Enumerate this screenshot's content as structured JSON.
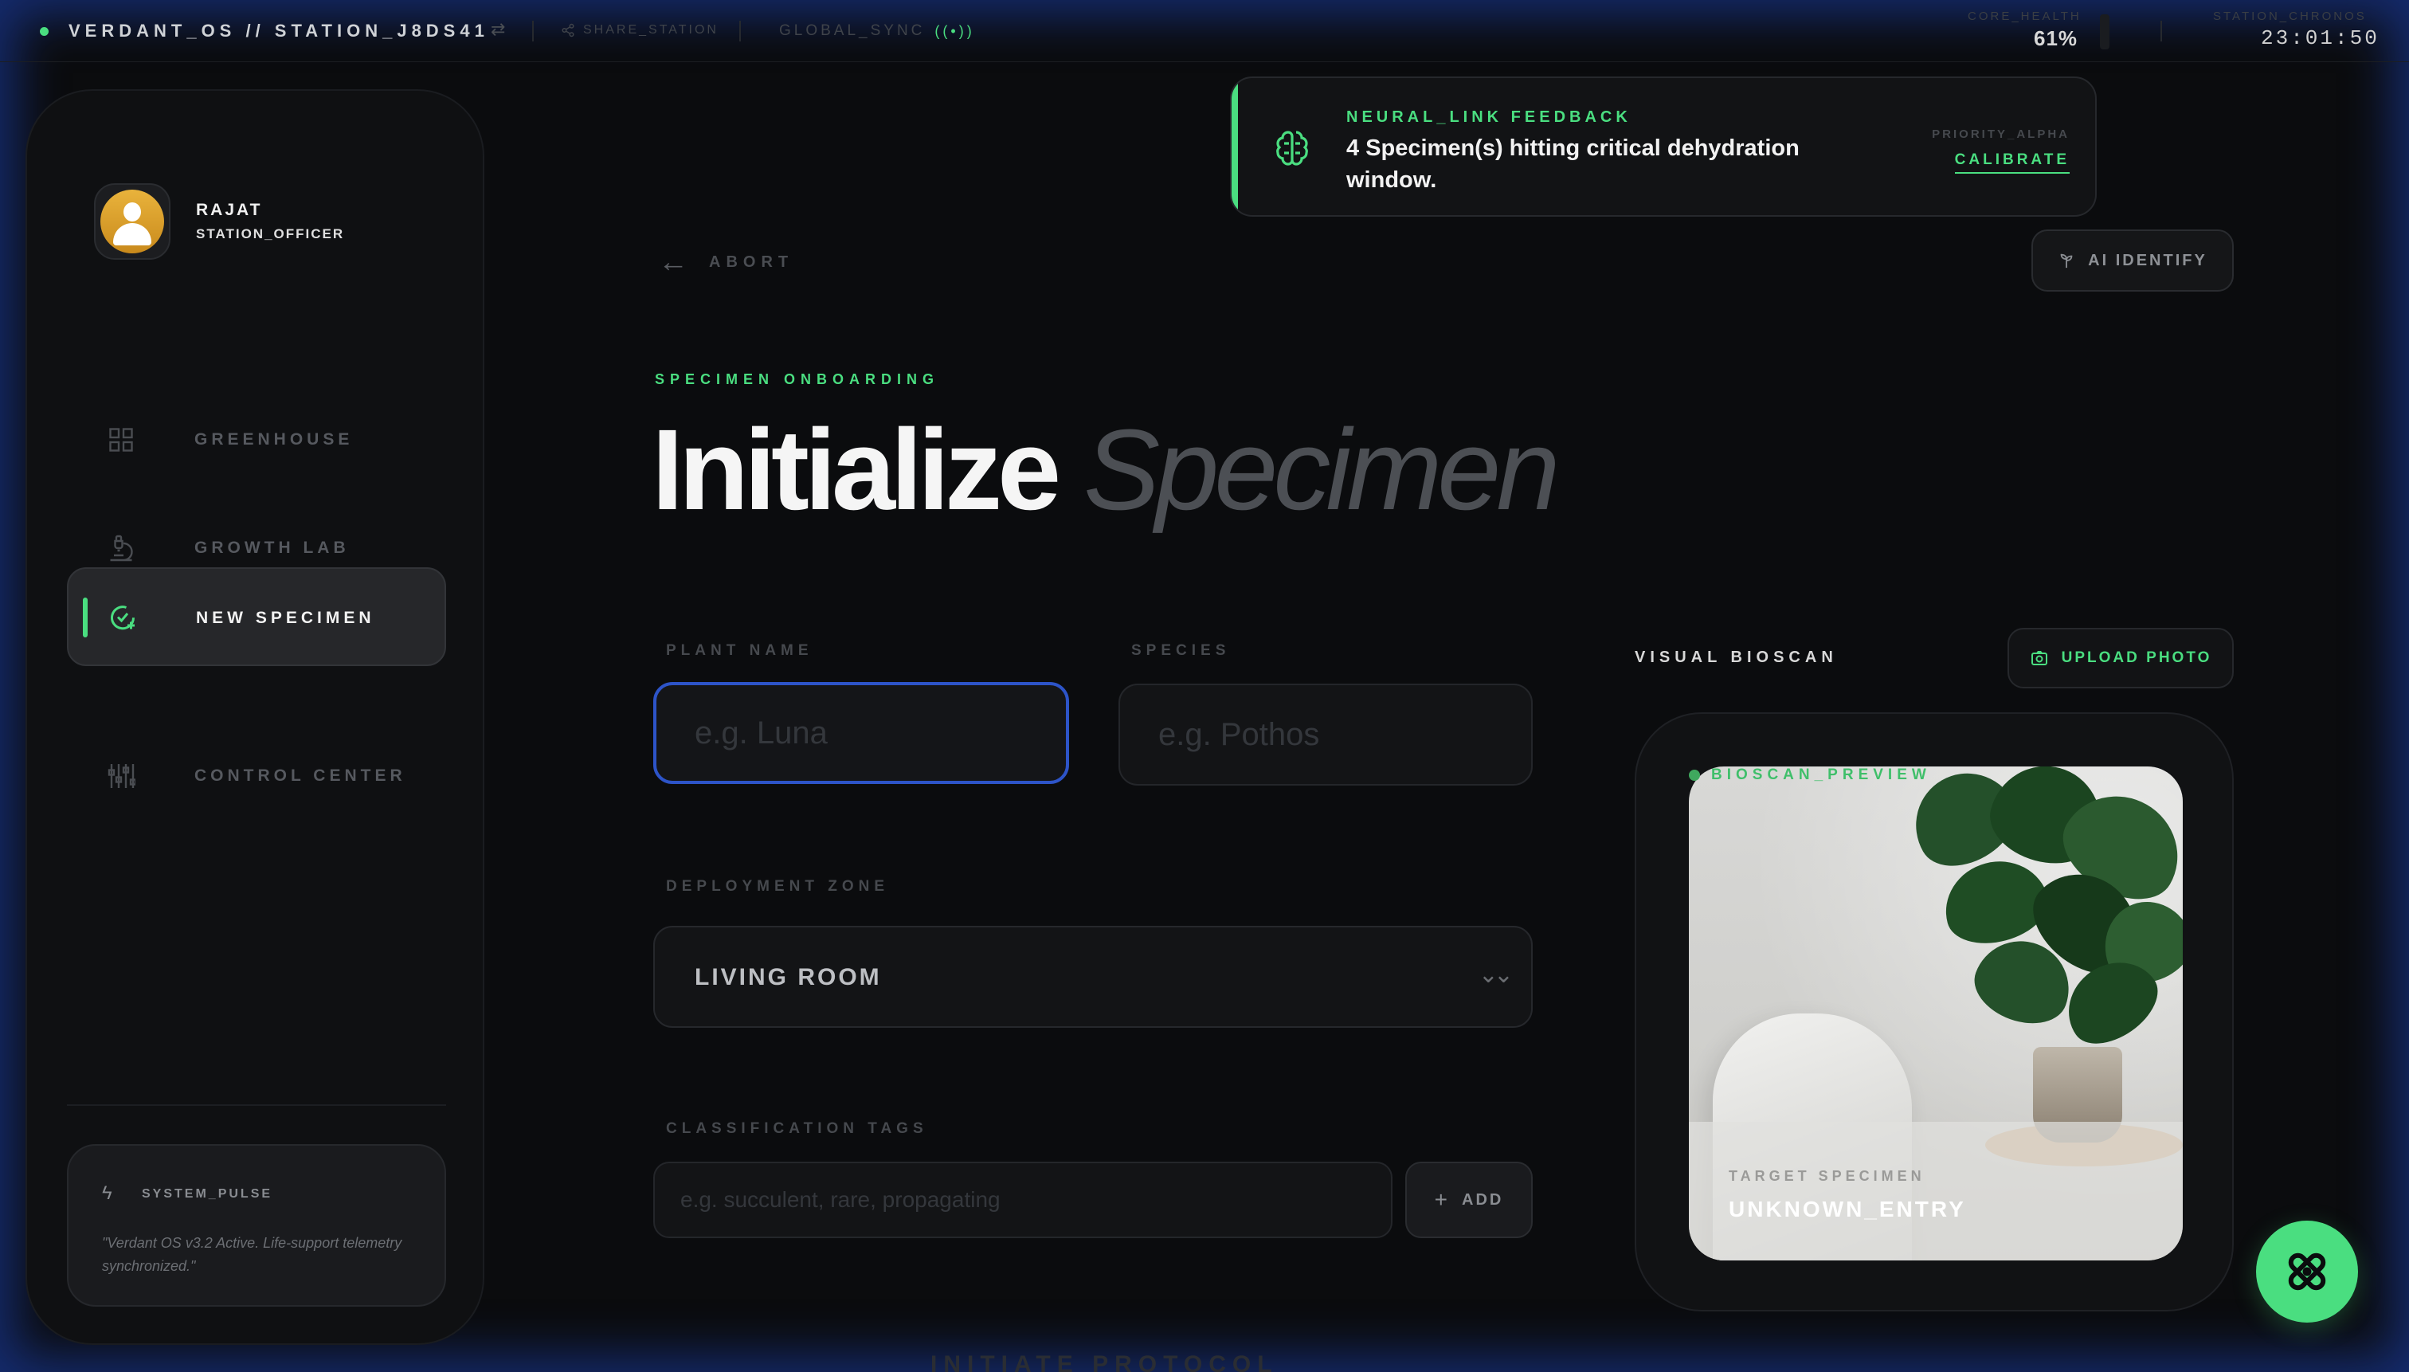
{
  "topbar": {
    "brand": "VERDANT_OS // STATION_J8DS41",
    "share": "SHARE_STATION",
    "sync": "GLOBAL_SYNC",
    "health_label": "CORE_HEALTH",
    "health_value": "61%",
    "chronos_label": "STATION_CHRONOS",
    "chronos_value": "23:01:50"
  },
  "user": {
    "name": "RAJAT",
    "role": "STATION_OFFICER"
  },
  "sidebar": {
    "items": [
      {
        "label": "GREENHOUSE",
        "icon": "grid-icon",
        "active": false
      },
      {
        "label": "GROWTH LAB",
        "icon": "microscope-icon",
        "active": false
      },
      {
        "label": "NEW SPECIMEN",
        "icon": "check-add-icon",
        "active": true
      },
      {
        "label": "CONTROL CENTER",
        "icon": "sliders-icon",
        "active": false
      }
    ],
    "pulse_label": "SYSTEM_PULSE",
    "pulse_text": "\"Verdant OS v3.2 Active. Life-support telemetry synchronized.\""
  },
  "notification": {
    "title": "NEURAL_LINK FEEDBACK",
    "message": "4 Specimen(s) hitting critical dehydration window.",
    "priority": "PRIORITY_ALPHA",
    "action": "CALIBRATE"
  },
  "header": {
    "abort": "ABORT",
    "ai_identify": "AI IDENTIFY",
    "eyebrow": "SPECIMEN ONBOARDING",
    "title_strong": "Initialize",
    "title_light": "Specimen"
  },
  "form": {
    "plant_name_label": "PLANT NAME",
    "plant_name_placeholder": "e.g. Luna",
    "species_label": "SPECIES",
    "species_placeholder": "e.g. Pothos",
    "zone_label": "DEPLOYMENT ZONE",
    "zone_value": "LIVING ROOM",
    "tags_label": "CLASSIFICATION TAGS",
    "tags_placeholder": "e.g. succulent, rare, propagating",
    "add_label": "ADD",
    "initiate_label": "INITIATE PROTOCOL"
  },
  "bioscan": {
    "label": "VISUAL BIOSCAN",
    "upload_label": "UPLOAD PHOTO",
    "preview_label": "BIOSCAN_PREVIEW",
    "target_label": "TARGET SPECIMEN",
    "target_value": "UNKNOWN_ENTRY"
  },
  "colors": {
    "accent": "#4ade80",
    "focus": "#2d54c8",
    "background": "#0b0c0e"
  }
}
